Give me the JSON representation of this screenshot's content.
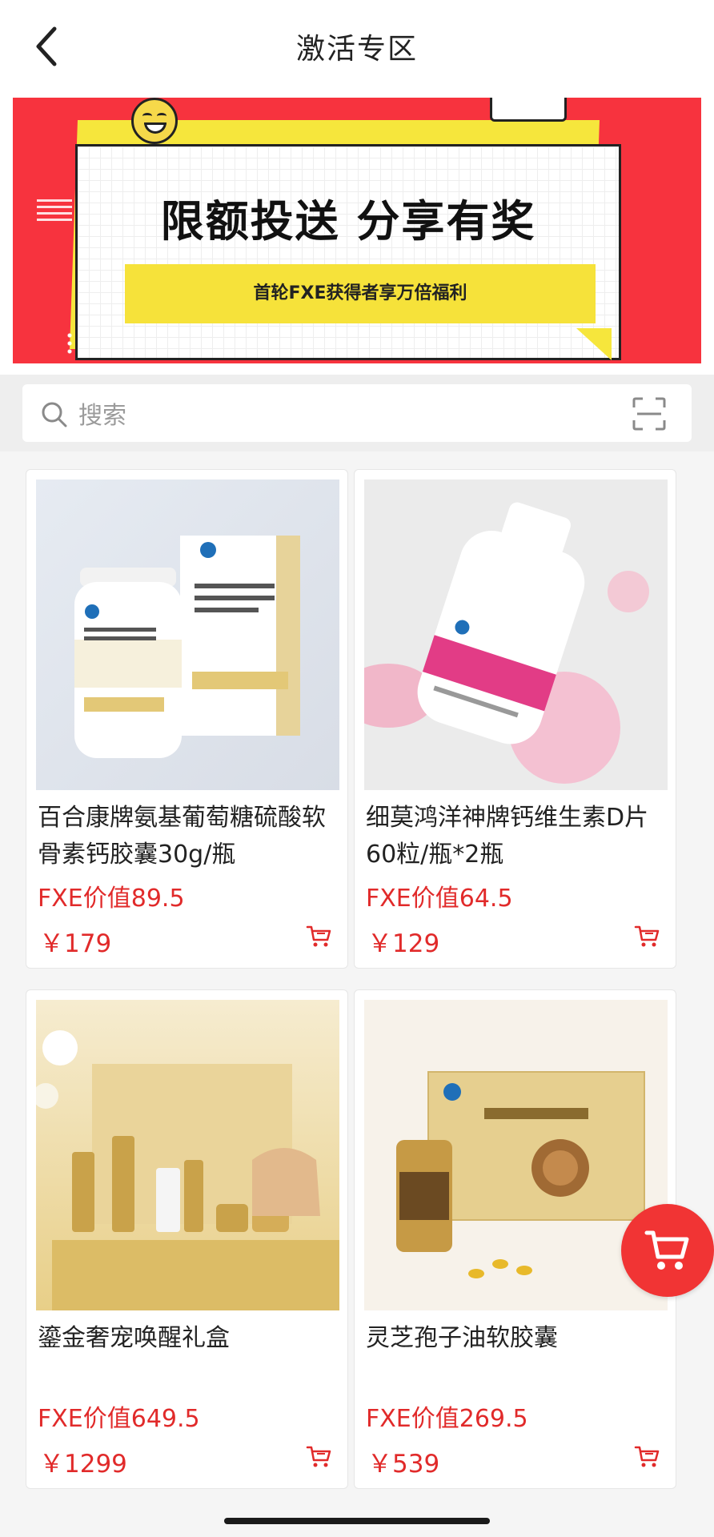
{
  "nav": {
    "title": "激活专区"
  },
  "banner": {
    "headline": "限额投送 分享有奖",
    "subline": "首轮FXE获得者享万倍福利"
  },
  "search": {
    "placeholder": "搜索"
  },
  "products": [
    {
      "name": "百合康牌氨基葡萄糖硫酸软骨素钙胶囊30g/瓶",
      "fxe": "FXE价值89.5",
      "price": "￥179"
    },
    {
      "name": "细莫鸿洋神牌钙维生素D片60粒/瓶*2瓶",
      "fxe": "FXE价值64.5",
      "price": "￥129"
    },
    {
      "name": "鎏金奢宠唤醒礼盒",
      "fxe": "FXE价值649.5",
      "price": "￥1299"
    },
    {
      "name": "灵芝孢子油软胶囊",
      "fxe": "FXE价值269.5",
      "price": "￥539"
    }
  ],
  "colors": {
    "accent": "#e12a2a",
    "banner_red": "#f7333e",
    "banner_yellow": "#f6e23a",
    "fab": "#f13434"
  },
  "icons": [
    "back-arrow-icon",
    "search-icon",
    "scan-icon",
    "cart-icon"
  ]
}
